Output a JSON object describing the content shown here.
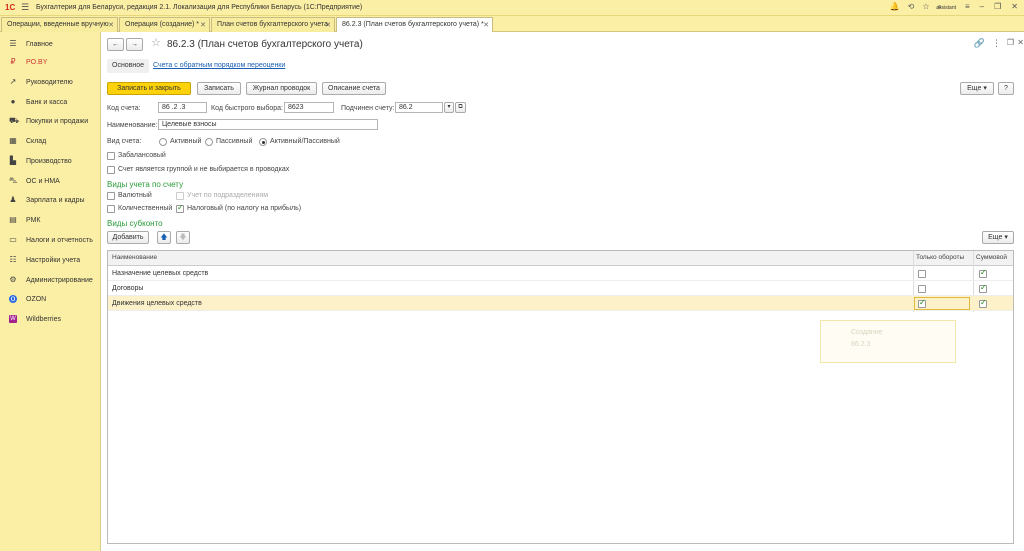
{
  "titlebar": {
    "logo": "1С",
    "app_title": "Бухгалтерия для Беларуси, редакция 2.1. Локализация для Республики Беларусь   (1С:Предприятие)",
    "user": "assistant"
  },
  "tabs": [
    {
      "label": "Операции, введенные вручную"
    },
    {
      "label": "Операция (создание) *"
    },
    {
      "label": "План счетов бухгалтерского учета"
    },
    {
      "label": "86.2.3 (План счетов бухгалтерского учета) *"
    }
  ],
  "sidebar": {
    "items": [
      {
        "label": "Главное",
        "icon": "menu-icon"
      },
      {
        "label": "PO.BY",
        "icon": "rupee-icon"
      },
      {
        "label": "Руководителю",
        "icon": "trend-icon"
      },
      {
        "label": "Банк и касса",
        "icon": "coin-icon"
      },
      {
        "label": "Покупки и продажи",
        "icon": "cart-icon"
      },
      {
        "label": "Склад",
        "icon": "warehouse-icon"
      },
      {
        "label": "Производство",
        "icon": "factory-icon"
      },
      {
        "label": "ОС и НМА",
        "icon": "truck-icon"
      },
      {
        "label": "Зарплата и кадры",
        "icon": "person-icon"
      },
      {
        "label": "РМК",
        "icon": "register-icon"
      },
      {
        "label": "Налоги и отчетность",
        "icon": "document-icon"
      },
      {
        "label": "Настройки учета",
        "icon": "settings-list-icon"
      },
      {
        "label": "Администрирование",
        "icon": "gear-icon"
      },
      {
        "label": "OZON",
        "icon": "ozon-icon"
      },
      {
        "label": "Wildberries",
        "icon": "wildberries-icon"
      }
    ]
  },
  "form": {
    "title": "86.2.3 (План счетов бухгалтерского учета)",
    "tab_main": "Основное",
    "tab_link": "Счета с обратным порядком переоценки",
    "btn_save_close": "Записать и закрыть",
    "btn_save": "Записать",
    "btn_journal": "Журнал проводок",
    "btn_description": "Описание счета",
    "btn_more": "Еще",
    "btn_help": "?",
    "code_label": "Код счета:",
    "code_value": "86 .2 .3",
    "quick_code_label": "Код быстрого выбора:",
    "quick_code_value": "8623",
    "parent_label": "Подчинен счету:",
    "parent_value": "86.2",
    "name_label": "Наименование:",
    "name_value": "Целевые взносы",
    "type_label": "Вид счета:",
    "type_options": [
      "Активный",
      "Пассивный",
      "Активный/Пассивный"
    ],
    "type_selected": "Активный/Пассивный",
    "offbalance_label": "Забалансовый",
    "group_label": "Счет является группой и не выбирается в проводках",
    "accounting_section": "Виды учета по счету",
    "currency_label": "Валютный",
    "subdivision_label": "Учет по подразделениям",
    "quantity_label": "Количественный",
    "tax_label": "Налоговый (по налогу на прибыль)",
    "subconto_section": "Виды субконто",
    "btn_add": "Добавить",
    "btn_more2": "Еще"
  },
  "grid": {
    "headers": [
      "Наименование",
      "Только обороты",
      "Суммовой"
    ],
    "rows": [
      {
        "name": "Назначение целевых средств",
        "turnover_only": false,
        "sum": true
      },
      {
        "name": "Договоры",
        "turnover_only": false,
        "sum": true
      },
      {
        "name": "Движения целевых средств",
        "turnover_only": true,
        "sum": true
      }
    ]
  },
  "ghost": {
    "line1": "Создание",
    "line2": "86.2.3"
  }
}
